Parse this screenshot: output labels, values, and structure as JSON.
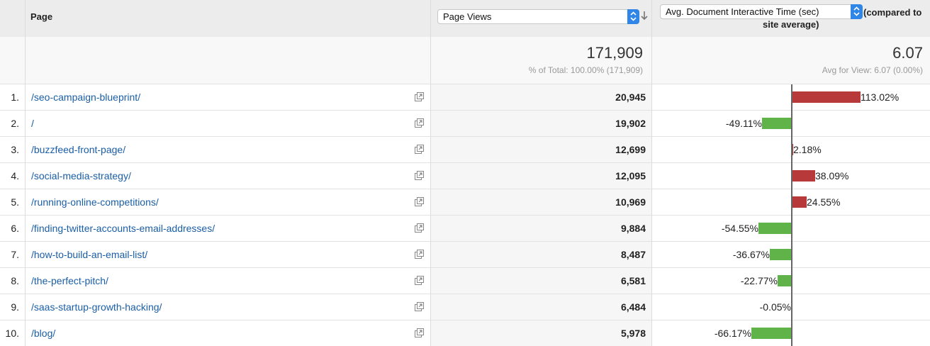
{
  "header": {
    "page_label": "Page",
    "metric_select": "Page Views",
    "compare_select": "Avg. Document Interactive Time (sec)",
    "compare_suffix_1": "(compared to",
    "compare_suffix_2": "site average)"
  },
  "summary": {
    "total": "171,909",
    "total_note": "% of Total: 100.00% (171,909)",
    "avg": "6.07",
    "avg_note": "Avg for View: 6.07 (0.00%)"
  },
  "colors": {
    "positive_bar": "#b8393a",
    "negative_bar": "#5fb349",
    "link": "#1a5ea6",
    "select_accent": "#2f86e6"
  },
  "icons": {
    "external_link": "open-window-icon",
    "sort": "sort-down-arrow-icon",
    "select": "select-updown-icon"
  },
  "rows": [
    {
      "idx": "1.",
      "page": "/seo-campaign-blueprint/",
      "views": "20,945",
      "delta": 113.02,
      "label": "113.02%"
    },
    {
      "idx": "2.",
      "page": "/",
      "views": "19,902",
      "delta": -49.11,
      "label": "-49.11%"
    },
    {
      "idx": "3.",
      "page": "/buzzfeed-front-page/",
      "views": "12,699",
      "delta": 2.18,
      "label": "2.18%"
    },
    {
      "idx": "4.",
      "page": "/social-media-strategy/",
      "views": "12,095",
      "delta": 38.09,
      "label": "38.09%"
    },
    {
      "idx": "5.",
      "page": "/running-online-competitions/",
      "views": "10,969",
      "delta": 24.55,
      "label": "24.55%"
    },
    {
      "idx": "6.",
      "page": "/finding-twitter-accounts-email-addresses/",
      "views": "9,884",
      "delta": -54.55,
      "label": "-54.55%"
    },
    {
      "idx": "7.",
      "page": "/how-to-build-an-email-list/",
      "views": "8,487",
      "delta": -36.67,
      "label": "-36.67%"
    },
    {
      "idx": "8.",
      "page": "/the-perfect-pitch/",
      "views": "6,581",
      "delta": -22.77,
      "label": "-22.77%"
    },
    {
      "idx": "9.",
      "page": "/saas-startup-growth-hacking/",
      "views": "6,484",
      "delta": -0.05,
      "label": "-0.05%"
    },
    {
      "idx": "10.",
      "page": "/blog/",
      "views": "5,978",
      "delta": -66.17,
      "label": "-66.17%"
    }
  ]
}
